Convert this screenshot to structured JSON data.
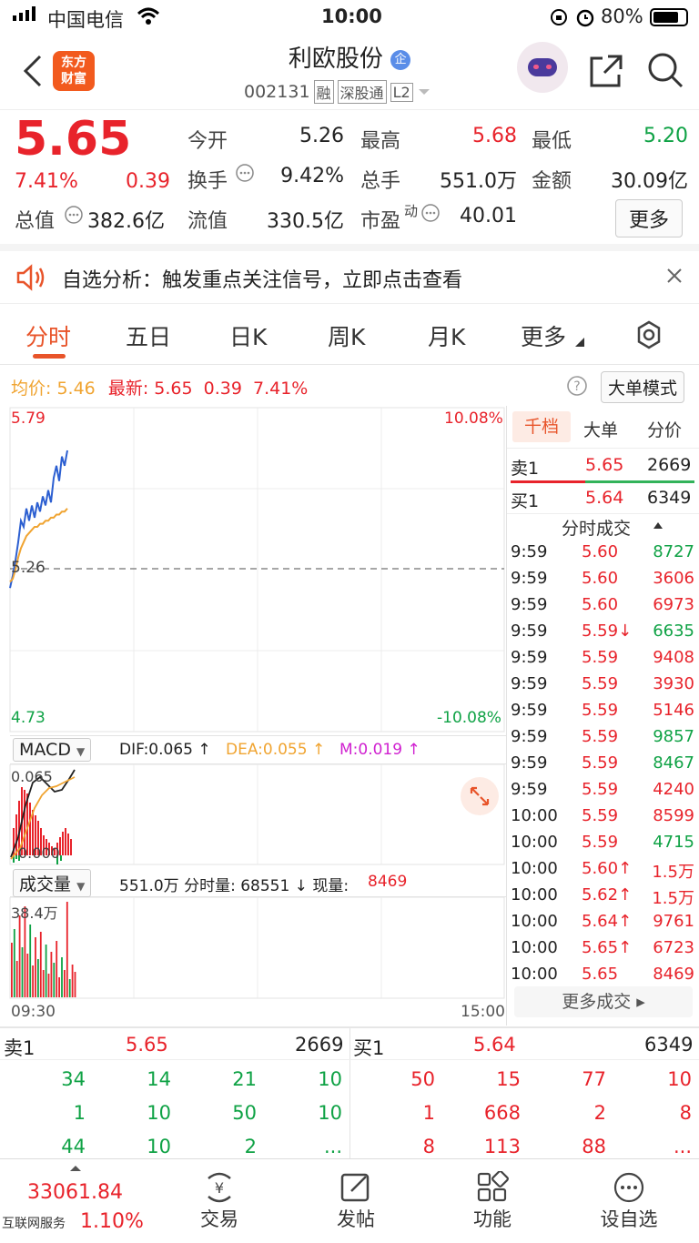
{
  "status_bar": {
    "carrier": "中国电信",
    "time": "10:00",
    "battery": "80%"
  },
  "header": {
    "logo_line1": "东方",
    "logo_line2": "财富",
    "stock_name": "利欧股份",
    "name_badge": "企",
    "code": "002131",
    "tags": [
      "融",
      "深股通",
      "L2"
    ]
  },
  "quote": {
    "price": "5.65",
    "change_pct": "7.41%",
    "change": "0.39",
    "total_value_label": "总值",
    "total_value": "382.6亿",
    "open_label": "今开",
    "open": "5.26",
    "high_label": "最高",
    "high": "5.68",
    "low_label": "最低",
    "low": "5.20",
    "turnover_label": "换手",
    "turnover": "9.42%",
    "volume_label": "总手",
    "volume": "551.0万",
    "amount_label": "金额",
    "amount": "30.09亿",
    "float_label": "流值",
    "float_value": "330.5亿",
    "pe_label": "市盈",
    "pe_super": "动",
    "pe": "40.01",
    "more_label": "更多"
  },
  "banner": {
    "text": "自选分析：触发重点关注信号，立即点击查看"
  },
  "tabs": [
    "分时",
    "五日",
    "日K",
    "周K",
    "月K",
    "更多"
  ],
  "info_line": {
    "avg_label": "均价:",
    "avg": "5.46",
    "latest_label": "最新:",
    "latest": "5.65",
    "change": "0.39",
    "pct": "7.41%",
    "mode_button": "大单模式"
  },
  "chart_data": {
    "type": "line",
    "x_labels": [
      "09:30",
      "15:00"
    ],
    "y_max": "5.79",
    "y_mid": "5.26",
    "y_min": "4.73",
    "pct_max": "10.08%",
    "pct_min": "-10.08%",
    "ylim": [
      4.73,
      5.79
    ],
    "series": [
      {
        "values": [
          5.2,
          5.24,
          5.29,
          5.35,
          5.42,
          5.4,
          5.46,
          5.42,
          5.47,
          5.43,
          5.48,
          5.45,
          5.5,
          5.47,
          5.52,
          5.48,
          5.56,
          5.6,
          5.55,
          5.63,
          5.6,
          5.65
        ]
      },
      {
        "values": [
          5.22,
          5.23,
          5.26,
          5.3,
          5.33,
          5.35,
          5.37,
          5.38,
          5.39,
          5.4,
          5.4,
          5.41,
          5.41,
          5.42,
          5.42,
          5.43,
          5.43,
          5.44,
          5.44,
          5.45,
          5.45,
          5.46
        ]
      }
    ],
    "macd": {
      "label": "MACD",
      "dif_label": "DIF:0.065 ↑",
      "dea_label": "DEA:0.055 ↑",
      "m_label": "M:0.019 ↑",
      "top": "0.065",
      "bottom": "0.000"
    },
    "volume": {
      "label": "成交量",
      "summary": "551.0万 分时量: 68551 ↓ 现量:",
      "current": "8469",
      "max_label": "38.4万"
    }
  },
  "depth_tabs": [
    "千档",
    "大单",
    "分价"
  ],
  "depth": {
    "sell_label": "卖1",
    "sell_price": "5.65",
    "sell_qty": "2669",
    "buy_label": "买1",
    "buy_price": "5.64",
    "buy_qty": "6349"
  },
  "trades_title": "分时成交",
  "trades": [
    {
      "t": "9:59",
      "p": "5.60",
      "v": "8727",
      "pc": "red",
      "vc": "green"
    },
    {
      "t": "9:59",
      "p": "5.60",
      "v": "3606",
      "pc": "red",
      "vc": "red"
    },
    {
      "t": "9:59",
      "p": "5.60",
      "v": "6973",
      "pc": "red",
      "vc": "red"
    },
    {
      "t": "9:59",
      "p": "5.59↓",
      "v": "6635",
      "pc": "red",
      "vc": "green"
    },
    {
      "t": "9:59",
      "p": "5.59",
      "v": "9408",
      "pc": "red",
      "vc": "red"
    },
    {
      "t": "9:59",
      "p": "5.59",
      "v": "3930",
      "pc": "red",
      "vc": "red"
    },
    {
      "t": "9:59",
      "p": "5.59",
      "v": "5146",
      "pc": "red",
      "vc": "red"
    },
    {
      "t": "9:59",
      "p": "5.59",
      "v": "9857",
      "pc": "red",
      "vc": "green"
    },
    {
      "t": "9:59",
      "p": "5.59",
      "v": "8467",
      "pc": "red",
      "vc": "green"
    },
    {
      "t": "9:59",
      "p": "5.59",
      "v": "4240",
      "pc": "red",
      "vc": "red"
    },
    {
      "t": "10:00",
      "p": "5.59",
      "v": "8599",
      "pc": "red",
      "vc": "red"
    },
    {
      "t": "10:00",
      "p": "5.59",
      "v": "4715",
      "pc": "red",
      "vc": "green"
    },
    {
      "t": "10:00",
      "p": "5.60↑",
      "v": "1.5万",
      "pc": "red",
      "vc": "red"
    },
    {
      "t": "10:00",
      "p": "5.62↑",
      "v": "1.5万",
      "pc": "red",
      "vc": "red"
    },
    {
      "t": "10:00",
      "p": "5.64↑",
      "v": "9761",
      "pc": "red",
      "vc": "red"
    },
    {
      "t": "10:00",
      "p": "5.65↑",
      "v": "6723",
      "pc": "red",
      "vc": "red"
    },
    {
      "t": "10:00",
      "p": "5.65",
      "v": "8469",
      "pc": "red",
      "vc": "red"
    }
  ],
  "more_trades": "更多成交",
  "book": {
    "sell_label": "卖1",
    "sell_price": "5.65",
    "sell_qty": "2669",
    "buy_label": "买1",
    "buy_price": "5.64",
    "buy_qty": "6349",
    "sell_rows": [
      [
        "34",
        "14",
        "21",
        "10"
      ],
      [
        "1",
        "10",
        "50",
        "10"
      ],
      [
        "44",
        "10",
        "2",
        "..."
      ]
    ],
    "buy_rows": [
      [
        "50",
        "15",
        "77",
        "10"
      ],
      [
        "1",
        "668",
        "2",
        "8"
      ],
      [
        "8",
        "113",
        "88",
        "..."
      ]
    ]
  },
  "bottom_bar": {
    "index_value": "33061.84",
    "index_label": "互联网服务",
    "index_pct": "1.10%",
    "items": [
      "交易",
      "发帖",
      "功能",
      "设自选"
    ]
  }
}
